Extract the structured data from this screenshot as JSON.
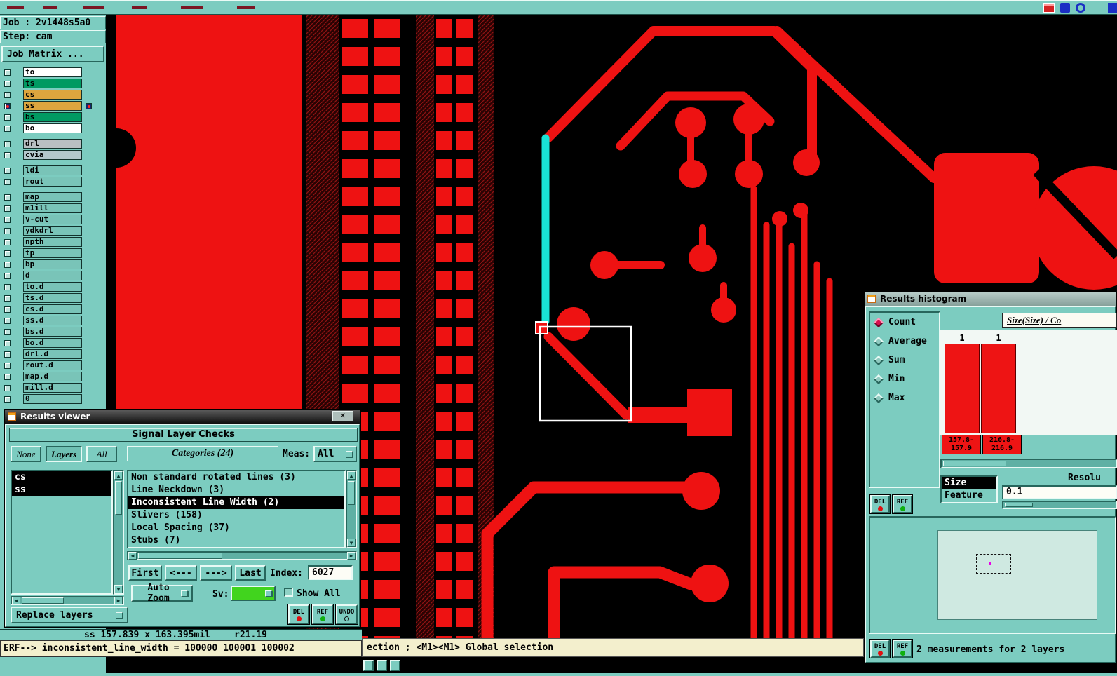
{
  "job_panel": {
    "job": "Job : 2v1448s5a0",
    "step": "Step: cam",
    "matrix_button": "Job Matrix ..."
  },
  "layer_list": {
    "groups": [
      {
        "rows": [
          {
            "label": "to",
            "color": "#ffffff"
          },
          {
            "label": "ts",
            "color": "#009a62"
          },
          {
            "label": "cs",
            "color": "#dda53e"
          },
          {
            "label": "ss",
            "color": "#dda53e",
            "selected": true
          },
          {
            "label": "bs",
            "color": "#009a62"
          },
          {
            "label": "bo",
            "color": "#ffffff"
          }
        ]
      },
      {
        "rows": [
          {
            "label": "drl",
            "color": "#b9bfc2"
          },
          {
            "label": "cvia",
            "color": "#b4c8cc"
          }
        ]
      },
      {
        "rows": [
          {
            "label": "ldi",
            "color": "#79c4b8"
          },
          {
            "label": "rout",
            "color": "#79c4b8"
          }
        ]
      },
      {
        "rows": [
          {
            "label": "map",
            "color": "#79c4b8"
          },
          {
            "label": "m1ill",
            "color": "#79c4b8"
          },
          {
            "label": "v-cut",
            "color": "#79c4b8"
          },
          {
            "label": "ydkdrl",
            "color": "#79c4b8"
          },
          {
            "label": "npth",
            "color": "#79c4b8"
          },
          {
            "label": "tp",
            "color": "#79c4b8"
          },
          {
            "label": "bp",
            "color": "#79c4b8"
          },
          {
            "label": "d",
            "color": "#79c4b8"
          },
          {
            "label": "to.d",
            "color": "#79c4b8"
          },
          {
            "label": "ts.d",
            "color": "#79c4b8"
          },
          {
            "label": "cs.d",
            "color": "#79c4b8"
          },
          {
            "label": "ss.d",
            "color": "#79c4b8"
          },
          {
            "label": "bs.d",
            "color": "#79c4b8"
          },
          {
            "label": "bo.d",
            "color": "#79c4b8"
          },
          {
            "label": "drl.d",
            "color": "#79c4b8"
          },
          {
            "label": "rout.d",
            "color": "#79c4b8"
          },
          {
            "label": "map.d",
            "color": "#79c4b8"
          },
          {
            "label": "mill.d",
            "color": "#79c4b8"
          },
          {
            "label": "0",
            "color": "#79c4b8"
          }
        ]
      }
    ]
  },
  "results_viewer": {
    "title": "Results viewer",
    "header": "Signal Layer Checks",
    "scope_buttons": [
      {
        "label": "None"
      },
      {
        "label": "Layers",
        "selected": true
      },
      {
        "label": "All"
      }
    ],
    "categories_header": "Categories (24)",
    "meas_label": "Meas:",
    "meas_value": "All",
    "layers_selected": [
      {
        "label": "cs"
      },
      {
        "label": "ss"
      }
    ],
    "categories": [
      {
        "label": "Non standard rotated lines (3)"
      },
      {
        "label": "Line Neckdown (3)"
      },
      {
        "label": "Inconsistent Line Width (2)",
        "selected": true
      },
      {
        "label": "Slivers (158)"
      },
      {
        "label": "Local Spacing (37)"
      },
      {
        "label": "Stubs (7)"
      }
    ],
    "nav": {
      "first": "First",
      "prev": "<---",
      "next": "--->",
      "last": "Last",
      "index_label": "Index:",
      "index_value": "6027"
    },
    "auto_zoom": "Auto Zoom",
    "sv_label": "Sv:",
    "show_all_label": "Show All",
    "del": "DEL",
    "ref": "REF",
    "undo": "UNDO",
    "replace_layers": "Replace layers",
    "measure_status": "ss 157.839 x 163.395mil",
    "radius_status": "r21.19",
    "erf_line": "ERF--> inconsistent_line_width = 100000 100001 100002"
  },
  "histogram": {
    "title": "Results histogram",
    "stats": [
      {
        "label": "Count",
        "selected": true
      },
      {
        "label": "Average"
      },
      {
        "label": "Sum"
      },
      {
        "label": "Min"
      },
      {
        "label": "Max"
      }
    ],
    "axis_header": "Size(Size) / Co",
    "bars": [
      {
        "value": "1",
        "range_top": "157.8-",
        "range_bottom": "157.9"
      },
      {
        "value": "1",
        "range_top": "216.8-",
        "range_bottom": "216.9"
      }
    ],
    "feature_modes": [
      {
        "label": "Size",
        "selected": true
      },
      {
        "label": "Feature"
      }
    ],
    "resolution_label": "Resolu",
    "resolution_value": "0.1",
    "del": "DEL",
    "ref": "REF",
    "footer": "2 measurements for 2 layers"
  },
  "status_bar": {
    "text": "ection ; <M1><M1> Global selection"
  },
  "icons": {
    "close": "✕",
    "up": "▲",
    "down": "▼",
    "left": "◀",
    "right": "▶"
  },
  "colors": {
    "pcb_red": "#ee1212",
    "highlight_cyan": "#19e2d6",
    "panel_teal": "#7cccc0",
    "status_cream": "#f3efcd",
    "selected_count": "#d8104e"
  }
}
